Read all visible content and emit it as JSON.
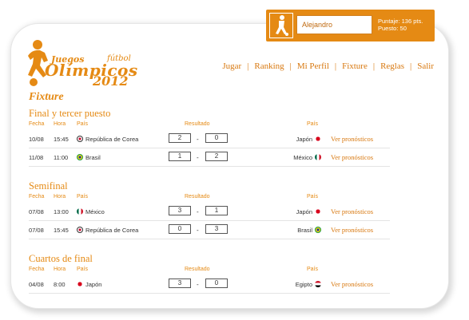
{
  "user": {
    "name": "Alejandro",
    "score_line": "Puntaje: 136 pts.",
    "position_line": "Puesto: 50"
  },
  "logo": {
    "juegos": "Juegos",
    "futbol": "fútbol",
    "olimpicos": "Olímpicos",
    "year": "2012"
  },
  "nav": [
    "Jugar",
    "Ranking",
    "Mi Perfil",
    "Fixture",
    "Reglas",
    "Salir"
  ],
  "page_title": "Fixture",
  "headers": {
    "fecha": "Fecha",
    "hora": "Hora",
    "pais": "País",
    "resultado": "Resultado",
    "pais2": "País"
  },
  "dash": "-",
  "sections": [
    {
      "title": "Final y tercer puesto",
      "rows": [
        {
          "date": "10/08",
          "time": "15:45",
          "home": "República de Corea",
          "home_flag": "korea",
          "score_home": "2",
          "score_away": "0",
          "away": "Japón",
          "away_flag": "japan",
          "link": "Ver pronósticos"
        },
        {
          "date": "11/08",
          "time": "11:00",
          "home": "Brasil",
          "home_flag": "brazil",
          "score_home": "1",
          "score_away": "2",
          "away": "México",
          "away_flag": "mexico",
          "link": "Ver pronósticos"
        }
      ]
    },
    {
      "title": "Semifinal",
      "rows": [
        {
          "date": "07/08",
          "time": "13:00",
          "home": "México",
          "home_flag": "mexico",
          "score_home": "3",
          "score_away": "1",
          "away": "Japón",
          "away_flag": "japan",
          "link": "Ver pronósticos"
        },
        {
          "date": "07/08",
          "time": "15:45",
          "home": "República de Corea",
          "home_flag": "korea",
          "score_home": "0",
          "score_away": "3",
          "away": "Brasil",
          "away_flag": "brazil",
          "link": "Ver pronósticos"
        }
      ]
    },
    {
      "title": "Cuartos de final",
      "rows": [
        {
          "date": "04/08",
          "time": "8:00",
          "home": "Japón",
          "home_flag": "japan",
          "score_home": "3",
          "score_away": "0",
          "away": "Egipto",
          "away_flag": "egypt",
          "link": "Ver pronósticos"
        }
      ]
    }
  ]
}
